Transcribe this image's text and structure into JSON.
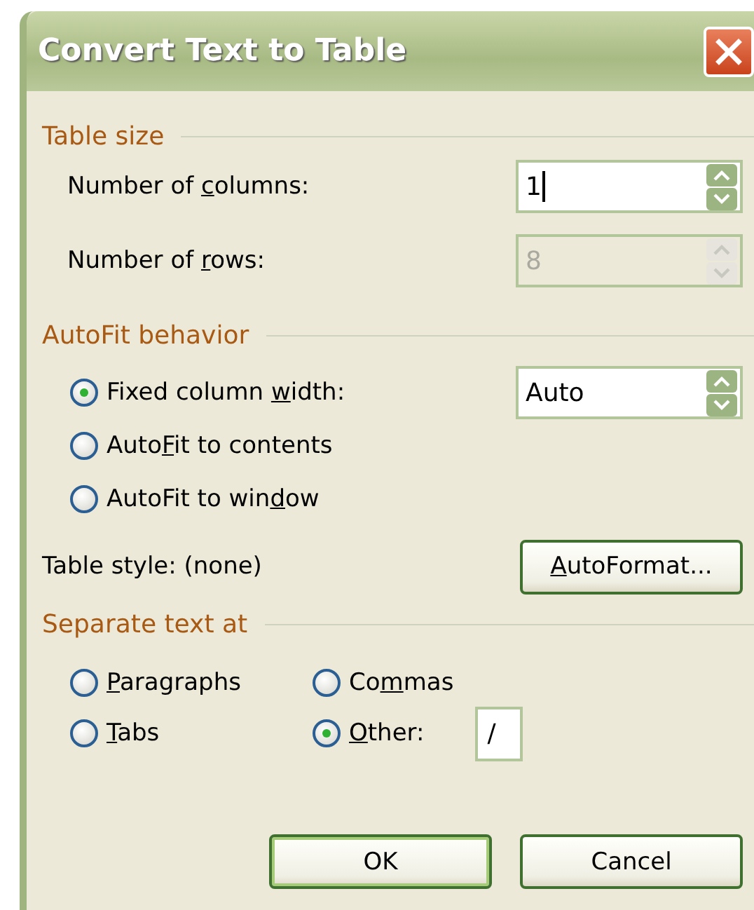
{
  "window": {
    "title": "Convert Text to Table"
  },
  "table_size": {
    "heading": "Table size",
    "fields": [
      {
        "label": {
          "pre": "Number of ",
          "key": "c",
          "post": "olumns:"
        },
        "value": "1",
        "disabled": false,
        "focused": true
      },
      {
        "label": {
          "pre": "Number of ",
          "key": "r",
          "post": "ows:"
        },
        "value": "8",
        "disabled": true,
        "focused": false
      }
    ]
  },
  "autofit": {
    "heading": "AutoFit behavior",
    "width_value": "Auto",
    "options": [
      {
        "label": {
          "pre": "Fixed column ",
          "key": "w",
          "post": "idth:"
        },
        "selected": true
      },
      {
        "label": {
          "pre": "Auto",
          "key": "F",
          "post": "it to contents"
        },
        "selected": false
      },
      {
        "label": {
          "pre": "AutoFit to win",
          "key": "d",
          "post": "ow"
        },
        "selected": false
      }
    ]
  },
  "table_style": {
    "label": "Table style:  (none)",
    "button": {
      "key": "A",
      "post": "utoFormat..."
    }
  },
  "separate": {
    "heading": "Separate text at",
    "options": [
      {
        "label": {
          "key": "P",
          "post": "aragraphs"
        },
        "selected": false
      },
      {
        "label": {
          "pre": "Co",
          "key": "m",
          "post": "mas"
        },
        "selected": false
      },
      {
        "label": {
          "key": "T",
          "post": "abs"
        },
        "selected": false
      },
      {
        "label": {
          "key": "O",
          "post": "ther:"
        },
        "selected": true,
        "value": "/"
      }
    ]
  },
  "buttons": [
    {
      "label": "OK",
      "default": true
    },
    {
      "label": "Cancel",
      "default": false
    }
  ]
}
